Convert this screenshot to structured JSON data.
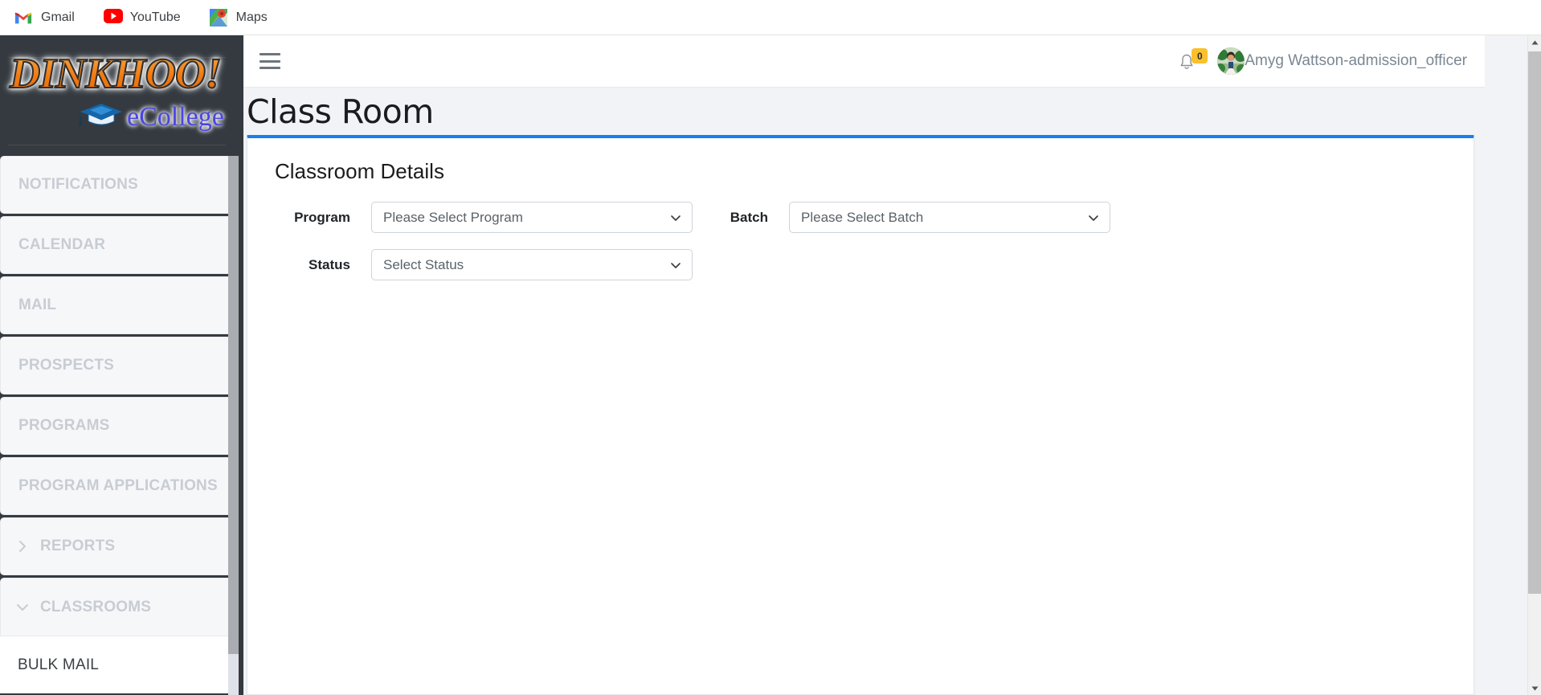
{
  "browser": {
    "bookmarks": [
      {
        "label": "Gmail",
        "icon": "gmail-icon"
      },
      {
        "label": "YouTube",
        "icon": "youtube-icon"
      },
      {
        "label": "Maps",
        "icon": "google-maps-icon"
      }
    ],
    "scrollbar": {
      "position_percent": 3
    }
  },
  "sidebar": {
    "brand": {
      "word": "DINKHOO!",
      "sub": "eCollege",
      "cap_icon": "graduation-cap-icon"
    },
    "items": [
      {
        "label": "NOTIFICATIONS",
        "chevron": null,
        "type": "card"
      },
      {
        "label": "CALENDAR",
        "chevron": null,
        "type": "card"
      },
      {
        "label": "MAIL",
        "chevron": null,
        "type": "card"
      },
      {
        "label": "PROSPECTS",
        "chevron": null,
        "type": "card"
      },
      {
        "label": "PROGRAMS",
        "chevron": null,
        "type": "card"
      },
      {
        "label": "PROGRAM APPLICATIONS",
        "chevron": null,
        "type": "card"
      },
      {
        "label": "REPORTS",
        "chevron": "chevron-right-icon",
        "type": "card"
      },
      {
        "label": "CLASSROOMS",
        "chevron": "chevron-down-icon",
        "type": "card"
      },
      {
        "label": "BULK MAIL",
        "chevron": null,
        "type": "sub"
      }
    ]
  },
  "topbar": {
    "menu_toggle_icon": "hamburger-menu-icon",
    "notifications": {
      "icon": "bell-icon",
      "count": "0",
      "badge_color": "#fbc02d"
    },
    "user": {
      "name": "Amyg Wattson-admission_officer",
      "avatar_icon": "user-avatar-photo"
    }
  },
  "page": {
    "title": "Class Room",
    "accent_color": "#1a7ef0"
  },
  "card": {
    "heading": "Classroom Details",
    "fields": [
      {
        "label": "Program",
        "name": "program-select",
        "value": "Please Select Program",
        "chevron": "chevron-down-icon"
      },
      {
        "label": "Batch",
        "name": "batch-select",
        "value": "Please Select Batch",
        "chevron": "chevron-down-icon"
      },
      {
        "label": "Status",
        "name": "status-select",
        "value": "Select Status",
        "chevron": "chevron-down-icon"
      }
    ]
  }
}
